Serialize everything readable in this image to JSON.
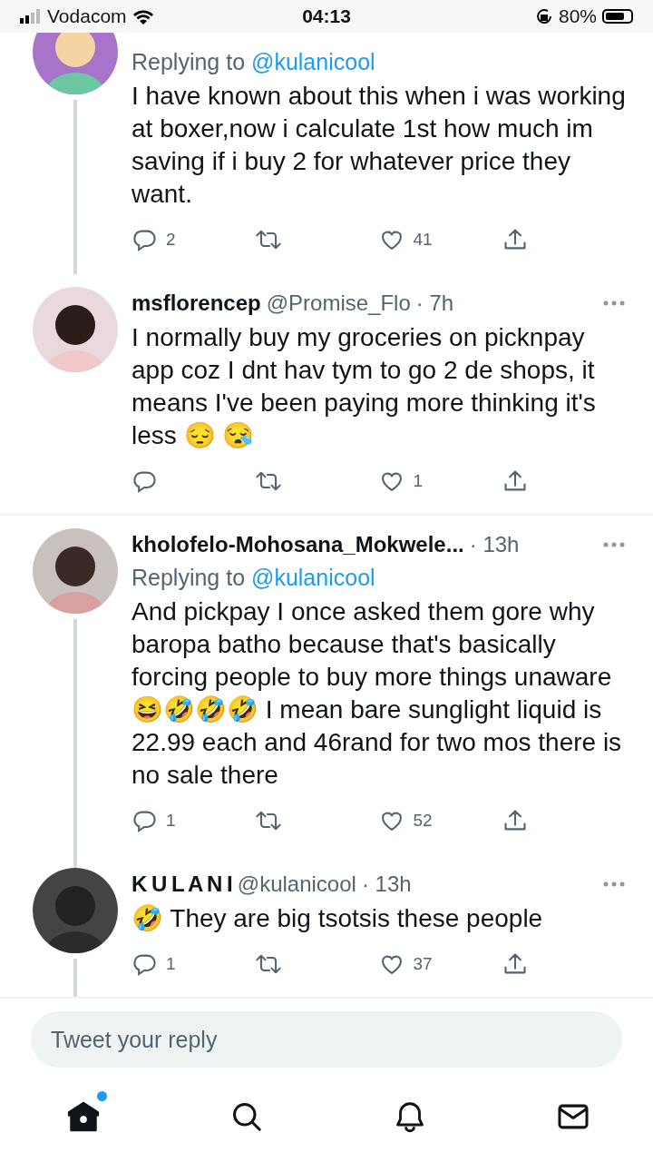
{
  "status_bar": {
    "carrier": "Vodacom",
    "time": "04:13",
    "battery": "80%"
  },
  "tweets": [
    {
      "replying_label": "Replying to",
      "replying_to": "@kulanicool",
      "text": "I have known about this when i was working at boxer,now i calculate 1st how much im saving if i buy 2 for whatever price they want.",
      "replies": "2",
      "likes": "41",
      "thread_below": true,
      "divider_after": false
    },
    {
      "name": "msflorencep",
      "handle": "@Promise_Flo",
      "time": "· 7h",
      "text": "I normally buy my groceries on picknpay app coz I dnt hav tym to go 2 de shops, it means I've been paying more thinking it's less 😔 😪",
      "likes": "1",
      "thread_below": false,
      "divider_after": true
    },
    {
      "name": "kholofelo-Mohosana_Mokwele...",
      "time": "· 13h",
      "replying_label": "Replying to",
      "replying_to": "@kulanicool",
      "text": "And pickpay I once asked them gore why baropa batho because that's basically forcing people to buy more things unaware 😆🤣🤣🤣  I mean bare sunglight liquid is 22.99 each and 46rand for two mos there is no sale there",
      "replies": "1",
      "likes": "52",
      "thread_below": true,
      "divider_after": false
    },
    {
      "name": "K U L A N I",
      "handle": "@kulanicool",
      "time": "· 13h",
      "text": "🤣 They are big tsotsis these people",
      "replies": "1",
      "likes": "37",
      "thread_above": true,
      "thread_below": true,
      "divider_after": true
    }
  ],
  "reply_box": {
    "placeholder": "Tweet your reply"
  },
  "nav": [
    {
      "kind": "home",
      "selected": true,
      "badge": true
    },
    {
      "kind": "search",
      "selected": false
    },
    {
      "kind": "notifications",
      "selected": false
    },
    {
      "kind": "messages",
      "selected": false
    }
  ]
}
